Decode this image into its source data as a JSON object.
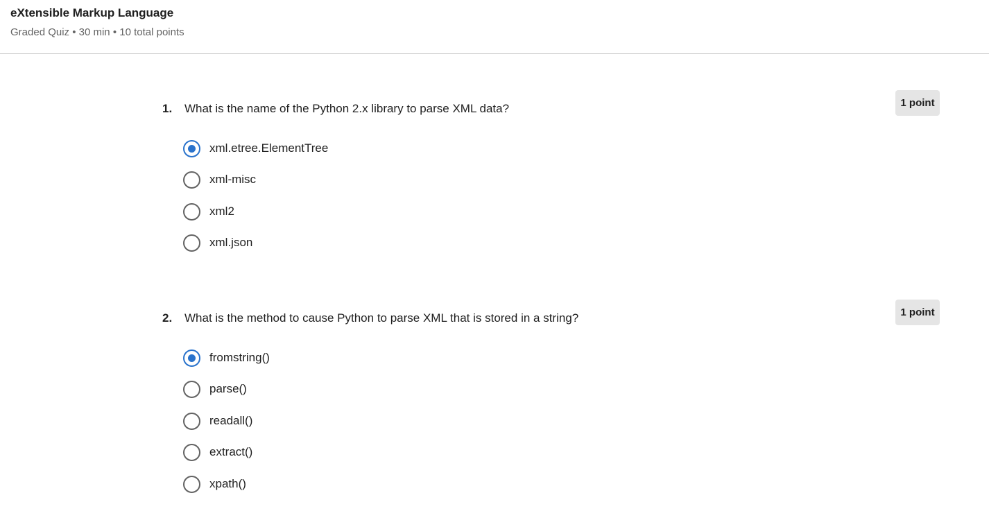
{
  "header": {
    "title": "eXtensible Markup Language",
    "meta": "Graded Quiz • 30 min • 10 total points"
  },
  "questions": [
    {
      "number": "1.",
      "text": "What is the name of the Python 2.x library to parse XML data?",
      "points": "1 point",
      "options": [
        {
          "label": "xml.etree.ElementTree",
          "selected": true
        },
        {
          "label": "xml-misc",
          "selected": false
        },
        {
          "label": "xml2",
          "selected": false
        },
        {
          "label": "xml.json",
          "selected": false
        }
      ]
    },
    {
      "number": "2.",
      "text": "What is the method to cause Python to parse XML that is stored in a string?",
      "points": "1 point",
      "options": [
        {
          "label": "fromstring()",
          "selected": true
        },
        {
          "label": "parse()",
          "selected": false
        },
        {
          "label": "readall()",
          "selected": false
        },
        {
          "label": "extract()",
          "selected": false
        },
        {
          "label": "xpath()",
          "selected": false
        }
      ]
    }
  ]
}
